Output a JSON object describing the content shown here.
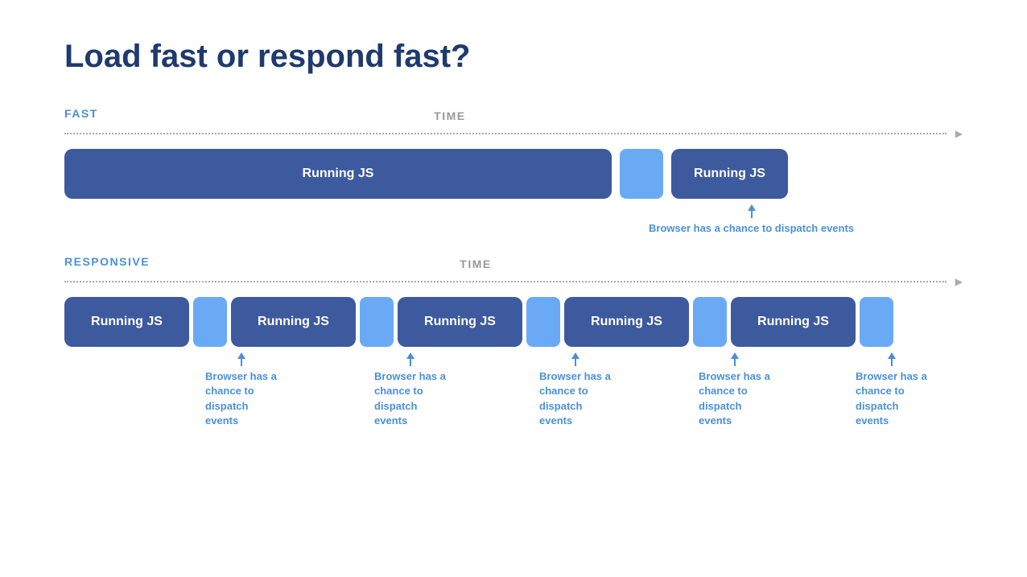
{
  "title": "Load fast or respond fast?",
  "fast_section": {
    "label": "FAST",
    "time_label": "TIME",
    "big_block_label": "Running JS",
    "small_block_label": "Running JS",
    "annotation": "Browser has a chance to dispatch events"
  },
  "responsive_section": {
    "label": "RESPONSIVE",
    "time_label": "TIME",
    "block_label": "Running JS",
    "annotations": [
      "Browser has a chance to dispatch events",
      "Browser has a chance to dispatch events",
      "Browser has a chance to dispatch events",
      "Browser has a chance to dispatch events",
      "Browser has a chance to dispatch events"
    ]
  }
}
